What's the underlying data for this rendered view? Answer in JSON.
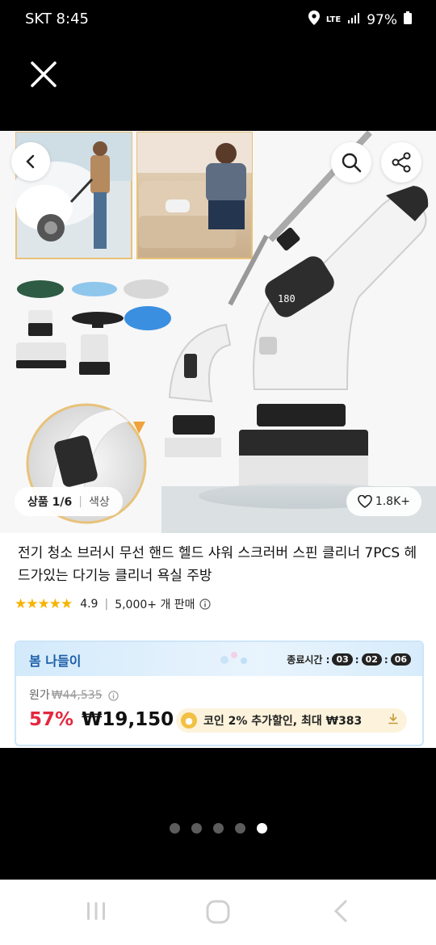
{
  "status": {
    "carrier_time": "SKT 8:45",
    "network": "LTE",
    "battery": "97%"
  },
  "product": {
    "tag_label": "상품 1/6",
    "tag_color": "색상",
    "likes": "1.8K+",
    "title": "전기 청소 브러시 무선 핸드 헬드 샤워 스크러버 스핀 클리너 7PCS 헤드가있는 다기능 클리너 욕실 주방",
    "rating": "4.9",
    "sales": "5,000+ 개 판매",
    "display_readout": "180"
  },
  "deal": {
    "title": "봄 나들이",
    "timer_label": "종료시간 :",
    "timer_h": "03",
    "timer_m": "02",
    "timer_s": "06",
    "orig_label": "원가",
    "orig_price": "₩44,535",
    "discount": "57%",
    "price": "₩19,150",
    "coin_text": "코인 2% 추가할인, 최대 ₩383"
  },
  "carousel": {
    "page_count": 5,
    "active_index": 4
  },
  "colors": {
    "accent": "#e4283f",
    "deal_blue": "#1c5ea8",
    "star": "#f5b400"
  }
}
